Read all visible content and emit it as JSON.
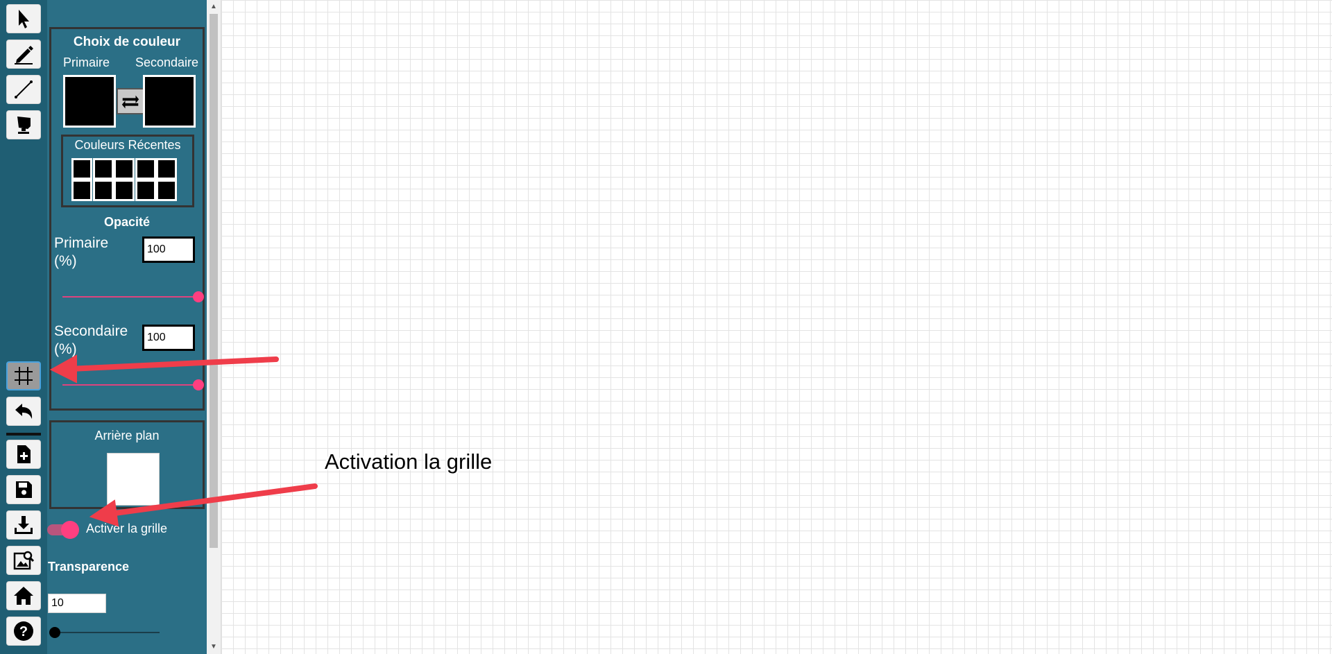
{
  "toolbar": {
    "tools": [
      {
        "name": "cursor-icon"
      },
      {
        "name": "pencil-icon"
      },
      {
        "name": "line-icon"
      },
      {
        "name": "brush-icon"
      },
      {
        "name": "grid-icon",
        "active": true
      },
      {
        "name": "undo-icon"
      },
      {
        "name": "new-file-icon"
      },
      {
        "name": "save-icon"
      },
      {
        "name": "download-icon"
      },
      {
        "name": "image-search-icon"
      },
      {
        "name": "home-icon"
      },
      {
        "name": "help-icon"
      }
    ]
  },
  "colors": {
    "title": "Choix de couleur",
    "primary_label": "Primaire",
    "secondary_label": "Secondaire",
    "primary_color": "#000000",
    "secondary_color": "#000000",
    "recent_title": "Couleurs Récentes",
    "recent": [
      "#000000",
      "#000000",
      "#000000",
      "#000000",
      "#000000",
      "#000000",
      "#000000",
      "#000000",
      "#000000",
      "#000000"
    ]
  },
  "opacity": {
    "title": "Opacité",
    "primary_label": "Primaire",
    "primary_unit": "(%)",
    "primary_value": "100",
    "secondary_label": "Secondaire",
    "secondary_unit": "(%)",
    "secondary_value": "100"
  },
  "background": {
    "title": "Arrière plan",
    "color": "#ffffff"
  },
  "grid": {
    "toggle_label": "Activer la grille",
    "enabled": true,
    "transparency_title": "Transparence",
    "transparency_value": "10"
  },
  "annotation": {
    "text": "Activation la grille",
    "arrow_color": "#ef3d4a"
  }
}
